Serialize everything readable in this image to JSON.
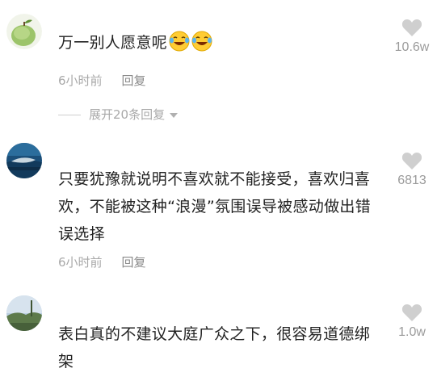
{
  "comments": [
    {
      "text": "万一别人愿意呢",
      "emojis": [
        "tears-of-joy-emoji",
        "tears-of-joy-emoji"
      ],
      "time": "6小时前",
      "reply_label": "回复",
      "likes": "10.6w"
    },
    {
      "text": "只要犹豫就说明不喜欢就不能接受，喜欢归喜欢，不能被这种“浪漫”氛围误导被感动做出错误选择",
      "time": "6小时前",
      "reply_label": "回复",
      "likes": "6813"
    },
    {
      "text": "表白真的不建议大庭广众之下，很容易道德绑架",
      "likes": "1.0w"
    }
  ],
  "expand_replies": {
    "label": "展开20条回复"
  },
  "icons": {
    "heart": "heart-icon",
    "expand": "triangle-down-icon"
  },
  "colors": {
    "text": "#222222",
    "meta": "#a9a9a9",
    "heart": "#cfcfcf"
  }
}
